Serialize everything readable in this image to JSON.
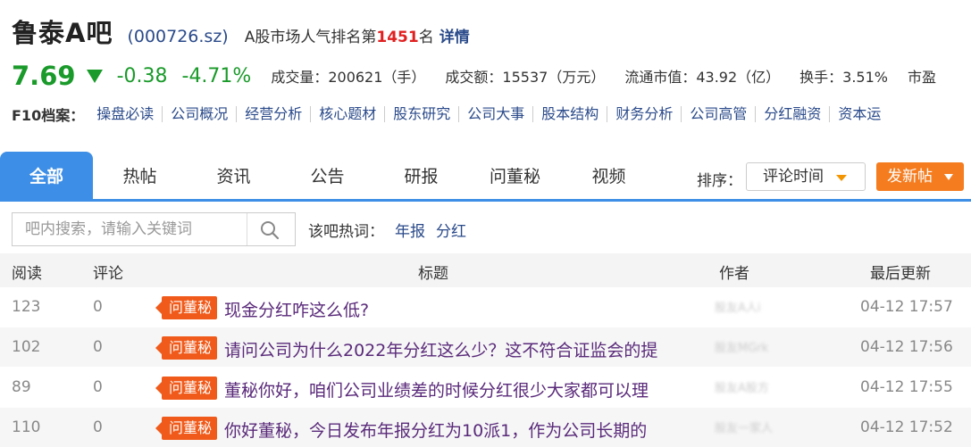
{
  "header": {
    "bar_name": "鲁泰A吧",
    "code": "(000726.sz)",
    "rank_prefix": "A股市场人气排名第",
    "rank_number": "1451",
    "rank_suffix": "名",
    "detail_link": "详情"
  },
  "quote": {
    "price": "7.69",
    "change": "-0.38",
    "change_pct": "-4.71%",
    "volume": "成交量：200621（手）",
    "turnover": "成交额：15537（万元）",
    "float_mkt_cap": "流通市值：43.92（亿）",
    "turnover_rate": "换手：3.51%",
    "pe": "市盈",
    "colors": {
      "down": "#1a9a2a",
      "up": "#e02020"
    }
  },
  "f10": {
    "title": "F10档案：",
    "links": [
      "操盘必读",
      "公司概况",
      "经营分析",
      "核心题材",
      "股东研究",
      "公司大事",
      "股本结构",
      "财务分析",
      "公司高管",
      "分红融资",
      "资本运"
    ]
  },
  "tabs": {
    "items": [
      "全部",
      "热帖",
      "资讯",
      "公告",
      "研报",
      "问董秘",
      "视频"
    ],
    "active": "全部",
    "sort_label": "排序：",
    "sort_value": "评论时间",
    "post_button": "发新帖",
    "accent": "#3d8ee6"
  },
  "search": {
    "placeholder": "吧内搜索，请输入关键词",
    "hot_label": "该吧热词：",
    "hot_words": [
      "年报",
      "分红"
    ]
  },
  "table": {
    "columns": [
      "阅读",
      "评论",
      "标题",
      "作者",
      "最后更新"
    ],
    "rows": [
      {
        "reads": "123",
        "comments": "0",
        "tag": "问董秘",
        "title": "现金分红咋这么低?",
        "author": "股友A人i",
        "updated": "04-12 17:57"
      },
      {
        "reads": "102",
        "comments": "0",
        "tag": "问董秘",
        "title": "请问公司为什么2022年分红这么少？这不符合证监会的提",
        "author": "股友MGrk",
        "updated": "04-12 17:56"
      },
      {
        "reads": "89",
        "comments": "0",
        "tag": "问董秘",
        "title": "董秘你好，咱们公司业绩差的时候分红很少大家都可以理",
        "author": "股友A股方",
        "updated": "04-12 17:55"
      },
      {
        "reads": "110",
        "comments": "0",
        "tag": "问董秘",
        "title": "你好董秘，今日发布年报分红为10派1，作为公司长期的",
        "author": "股友一家人",
        "updated": "04-12 17:52"
      }
    ]
  }
}
